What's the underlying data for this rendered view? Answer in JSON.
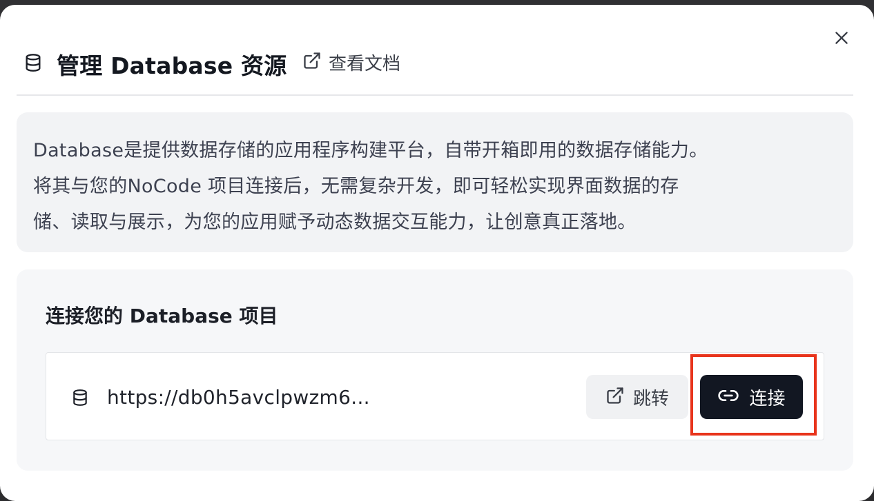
{
  "dialog": {
    "title": "管理 Database 资源",
    "docs_link_label": "查看文档",
    "header_icon": "database-icon",
    "close_icon": "close-icon"
  },
  "description": {
    "lines": [
      "Database是提供数据存储的应用程序构建平台，自带开箱即用的数据存储能力。",
      "将其与您的NoCode 项目连接后，无需复杂开发，即可轻松实现界面数据的存",
      "储、读取与展示，为您的应用赋予动态数据交互能力，让创意真正落地。"
    ]
  },
  "connect_section": {
    "title": "连接您的 Database 项目",
    "project": {
      "url": "https://db0h5avclpwzm6...",
      "icon": "database-icon",
      "jump_label": "跳转",
      "jump_icon": "external-link-icon",
      "connect_label": "连接",
      "connect_icon": "link-icon"
    }
  },
  "colors": {
    "primary_button": "#121722",
    "highlight": "#e8341c",
    "card_background": "#f2f3f5"
  }
}
